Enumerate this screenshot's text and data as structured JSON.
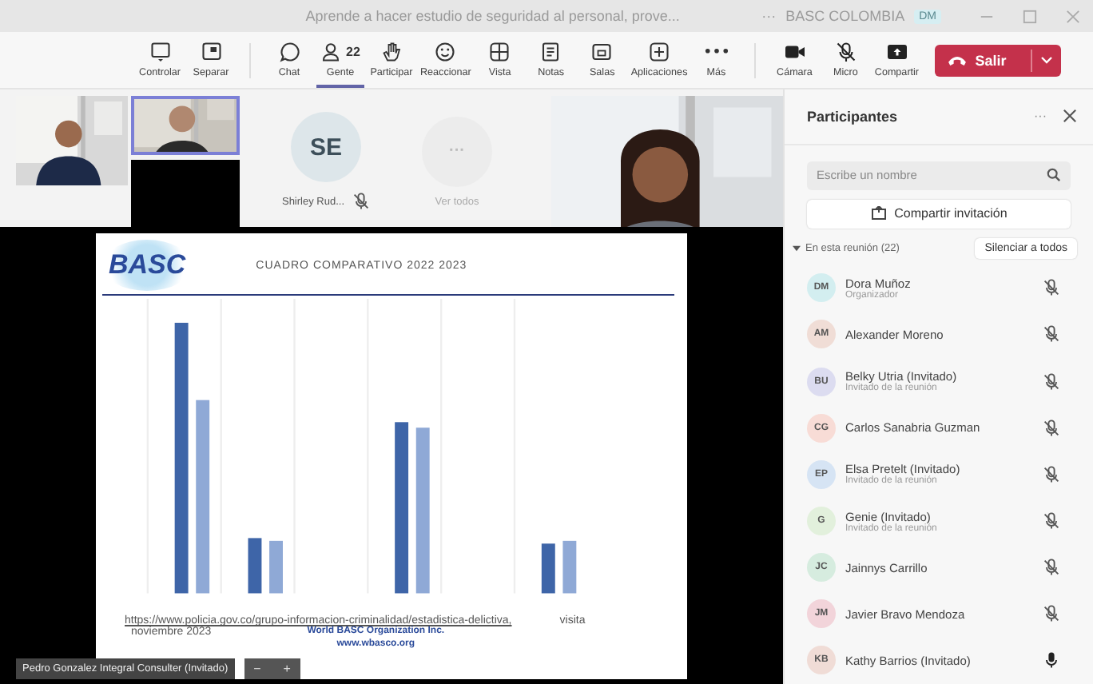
{
  "window": {
    "title": "Aprende a hacer estudio de seguridad al personal, prove...",
    "more": "···",
    "org": "BASC COLOMBIA",
    "account_initials": "DM"
  },
  "toolbar": {
    "items": [
      {
        "kind": "share-tray",
        "label": "Controlar",
        "selected": false
      },
      {
        "kind": "popout",
        "label": "Separar",
        "selected": false
      },
      {
        "kind": "chat",
        "label": "Chat",
        "selected": false
      },
      {
        "kind": "people",
        "label": "Gente",
        "count": "22",
        "selected": true
      },
      {
        "kind": "hand",
        "label": "Participar",
        "selected": false
      },
      {
        "kind": "react",
        "label": "Reaccionar",
        "selected": false
      },
      {
        "kind": "view",
        "label": "Vista",
        "selected": false
      },
      {
        "kind": "notes",
        "label": "Notas",
        "selected": false
      },
      {
        "kind": "rooms",
        "label": "Salas",
        "selected": false
      },
      {
        "kind": "apps",
        "label": "Aplicaciones",
        "selected": false
      },
      {
        "kind": "more",
        "label": "Más",
        "selected": false
      }
    ],
    "devices": [
      {
        "kind": "camera",
        "label": "Cámara"
      },
      {
        "kind": "mic-off",
        "label": "Micro"
      },
      {
        "kind": "share",
        "label": "Compartir"
      }
    ],
    "leave": "Salir"
  },
  "stage": {
    "tiles": [
      {
        "kind": "picture"
      },
      {
        "kind": "picture",
        "selected": true
      },
      {
        "kind": "blank"
      },
      {
        "kind": "avatar",
        "initials": "SE",
        "name": "Shirley Rud...",
        "muted": true
      },
      {
        "kind": "more",
        "glyph": "···",
        "name": "Ver todos"
      },
      {
        "kind": "picture"
      }
    ],
    "slide": {
      "logo": "BASC",
      "title": "CUADRO COMPARATIVO 2022 2023",
      "link": "https://www.policia.gov.co/grupo-informacion-criminalidad/estadistica-delictiva,",
      "link_suffix": "visita",
      "date": "noviembre 2023",
      "footer": "World BASC Organization Inc.",
      "website": "www.wbasco.org"
    },
    "presenter": "Pedro Gonzalez Integral Consulter (Invitado)",
    "zoom": [
      "−",
      "+"
    ]
  },
  "sidebar": {
    "title": "Participantes",
    "more": "···",
    "search": {
      "placeholder": "Escribe un nombre"
    },
    "invite": "Compartir invitación",
    "section": {
      "label": "En esta reunión (22)",
      "expanded": true,
      "mute_all": "Silenciar a todos"
    },
    "participants": [
      {
        "initials": "DM",
        "name": "Dora Muñoz",
        "role": "Organizador",
        "color": "#d3eef0",
        "muted": true
      },
      {
        "initials": "AM",
        "name": "Alexander Moreno",
        "color": "#f0ddd6",
        "muted": true
      },
      {
        "initials": "BU",
        "name": "Belky Utria (Invitado)",
        "role": "Invitado de la reunión",
        "color": "#dcdcf0",
        "muted": true
      },
      {
        "initials": "CG",
        "name": "Carlos Sanabria Guzman",
        "color": "#f8dcd6",
        "muted": true
      },
      {
        "initials": "EP",
        "name": "Elsa Pretelt (Invitado)",
        "role": "Invitado de la reunión",
        "color": "#d6e4f4",
        "muted": true
      },
      {
        "initials": "G",
        "name": "Genie (Invitado)",
        "role": "Invitado de la reunión",
        "color": "#e2f0dc",
        "muted": true
      },
      {
        "initials": "JC",
        "name": "Jainnys Carrillo",
        "color": "#d6ecdf",
        "muted": true
      },
      {
        "initials": "JM",
        "name": "Javier Bravo Mendoza",
        "color": "#f2d4da",
        "muted": true
      },
      {
        "initials": "KB",
        "name": "Kathy Barrios (Invitado)",
        "color": "#f0dcd6",
        "muted": false
      }
    ]
  }
}
